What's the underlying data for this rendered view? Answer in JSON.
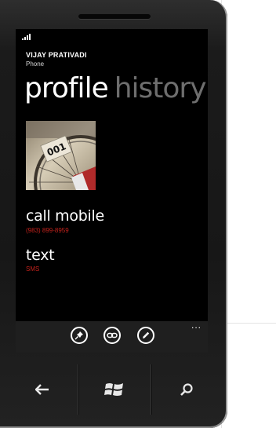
{
  "status_bar": {
    "signal_icon": "signal-bars-icon"
  },
  "contact": {
    "name": "VIJAY PRATIVADI",
    "subtitle": "Phone"
  },
  "pivot": {
    "active": "profile",
    "inactive": "history"
  },
  "photo": {
    "tag_number": "001"
  },
  "actions": [
    {
      "label": "call mobile",
      "detail": "(983) 899-8959"
    },
    {
      "label": "text",
      "detail": "SMS"
    }
  ],
  "appbar": {
    "buttons": [
      "pin-icon",
      "link-icon",
      "edit-icon"
    ],
    "more": "..."
  },
  "hardware_keys": [
    "back-icon",
    "windows-start-icon",
    "search-icon"
  ],
  "colors": {
    "accent": "#c2221c",
    "screen_bg": "#000000",
    "pivot_inactive": "#6e6e6e"
  }
}
